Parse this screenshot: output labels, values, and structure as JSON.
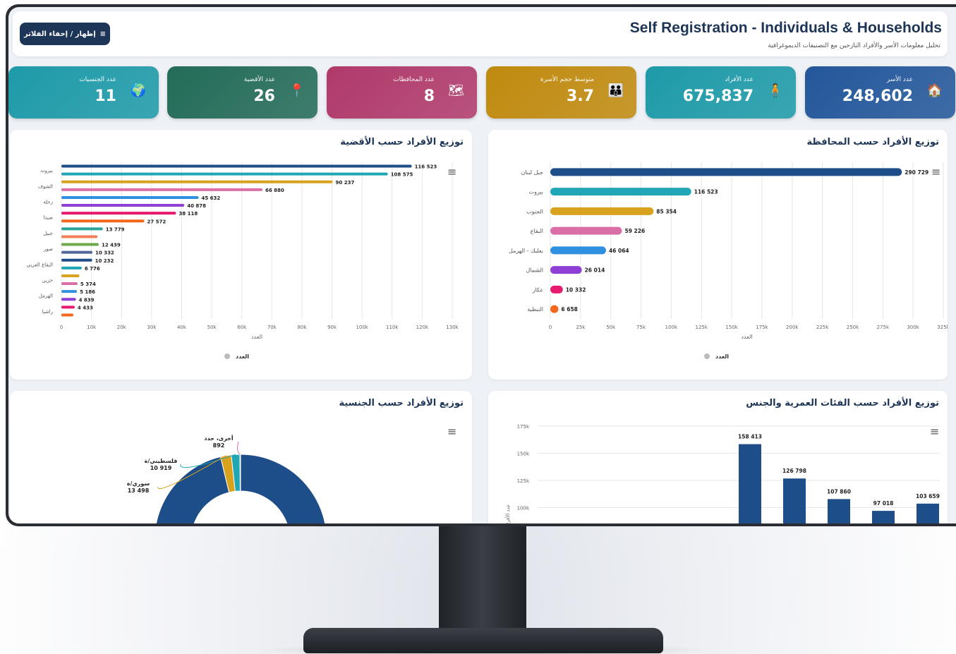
{
  "header": {
    "toggle_label": "إظهار / إخفاء الفلاتر",
    "toggle_icon": "≡",
    "title": "Self Registration - Individuals & Households",
    "subtitle": "تحليل معلومات الأسر والأفراد النازحين مع التصنيفات الديموغرافية"
  },
  "kpis": [
    {
      "label": "عدد الجنسيات",
      "value": "11",
      "icon": "globe-icon",
      "glyph": "🌍",
      "color": "#1e9aa8"
    },
    {
      "label": "عدد الأقضية",
      "value": "26",
      "icon": "pin-icon",
      "glyph": "📍",
      "color": "#236b58"
    },
    {
      "label": "عدد المحافظات",
      "value": "8",
      "icon": "map-icon",
      "glyph": "🗺",
      "color": "#b03a6a"
    },
    {
      "label": "متوسط حجم الأسرة",
      "value": "3.7",
      "icon": "family-icon",
      "glyph": "👪",
      "color": "#c08a0e"
    },
    {
      "label": "عدد الأفراد",
      "value": "675,837",
      "icon": "person-icon",
      "glyph": "🧍",
      "color": "#1e9aa8"
    },
    {
      "label": "عدد الأسر",
      "value": "248,602",
      "icon": "home-icon",
      "glyph": "🏠",
      "color": "#23579a"
    }
  ],
  "panels": {
    "district": "توزيع الأفراد حسب الأقضية",
    "governorate": "توزيع الأفراد حسب المحافظة",
    "nationality": "توزيع الأفراد حسب الجنسية",
    "age": "توزيع الأفراد حسب الفئات العمرية والجنس",
    "menu_glyph": "≡",
    "x_axis_label": "العدد",
    "legend_label": "العدد",
    "age_y_label": "عدد الأفراد"
  },
  "chart_data": [
    {
      "type": "bar",
      "orientation": "horizontal",
      "title": "توزيع الأفراد حسب الأقضية",
      "xlabel": "العدد",
      "xlim": [
        0,
        130000
      ],
      "xticks": [
        "0",
        "10k",
        "20k",
        "30k",
        "40k",
        "50k",
        "60k",
        "70k",
        "80k",
        "90k",
        "100k",
        "110k",
        "120k",
        "130k"
      ],
      "yticks": [
        "بيروت",
        "الشوف",
        "زحلة",
        "صيدا",
        "جبيل",
        "صور",
        "البقاع الغربي",
        "جزين",
        "الهرمل",
        "راشيا"
      ],
      "values": [
        116523,
        108575,
        90237,
        66880,
        45632,
        40878,
        38118,
        27572,
        13779,
        12000,
        12439,
        10332,
        10232,
        6776,
        6000,
        5374,
        5186,
        4839,
        4433,
        4000
      ],
      "value_labels": [
        "116 523",
        "108 575",
        "90 237",
        "66 880",
        "45 632",
        "40 878",
        "38 118",
        "27 572",
        "13 779",
        "",
        "12 439",
        "10 332",
        "10 232",
        "6 776",
        "",
        "5 374",
        "5 186",
        "4 839",
        "4 433",
        ""
      ],
      "colors": [
        "#1d4e89",
        "#20a6b4",
        "#d9a21e",
        "#d96fa6",
        "#2f8fe0",
        "#8e3fd6",
        "#e81a6e",
        "#f4661b",
        "#2aa39a",
        "#f07f5a",
        "#6fa84a",
        "#50679a",
        "#1d4e89",
        "#20a6b4",
        "#d9a21e",
        "#d96fa6",
        "#2f8fe0",
        "#8e3fd6",
        "#e81a6e",
        "#f4661b"
      ],
      "legend": [
        "العدد"
      ]
    },
    {
      "type": "bar",
      "orientation": "horizontal",
      "title": "توزيع الأفراد حسب المحافظة",
      "xlabel": "العدد",
      "xlim": [
        0,
        325000
      ],
      "xticks": [
        "0",
        "25k",
        "50k",
        "75k",
        "100k",
        "125k",
        "150k",
        "175k",
        "200k",
        "225k",
        "250k",
        "275k",
        "300k",
        "325k"
      ],
      "categories": [
        "جبل لبنان",
        "بيروت",
        "الجنوب",
        "البقاع",
        "بعلبك - الهرمل",
        "الشمال",
        "عكار",
        "النبطية"
      ],
      "values": [
        290729,
        116523,
        85354,
        59226,
        46064,
        26014,
        10332,
        6658
      ],
      "value_labels": [
        "290 729",
        "116 523",
        "85 354",
        "59 226",
        "46 064",
        "26 014",
        "10 332",
        "6 658"
      ],
      "colors": [
        "#1d4e89",
        "#20a6b4",
        "#d9a21e",
        "#d96fa6",
        "#2f8fe0",
        "#8e3fd6",
        "#e81a6e",
        "#f4661b"
      ],
      "legend": [
        "العدد"
      ]
    },
    {
      "type": "pie",
      "title": "توزيع الأفراد حسب الجنسية",
      "labels": [
        "أخرى، حدد",
        "فلسطيني/ة",
        "سوري/ة"
      ],
      "values": [
        892,
        10919,
        13498
      ],
      "value_labels": [
        "892",
        "10 919",
        "13 498"
      ],
      "colors": [
        "#d96fa6",
        "#20a6b4",
        "#d9a21e"
      ],
      "main_color": "#1d4e89"
    },
    {
      "type": "bar",
      "title": "توزيع الأفراد حسب الفئات العمرية والجنس",
      "ylabel": "عدد الأفراد",
      "ylim": [
        0,
        175000
      ],
      "yticks": [
        "175k",
        "150k",
        "125k",
        "100k"
      ],
      "values": [
        158413,
        126798,
        107860,
        97018,
        103659
      ],
      "value_labels": [
        "158 413",
        "126 798",
        "107 860",
        "97 018",
        "103 659"
      ],
      "color": "#1d4e89"
    }
  ]
}
